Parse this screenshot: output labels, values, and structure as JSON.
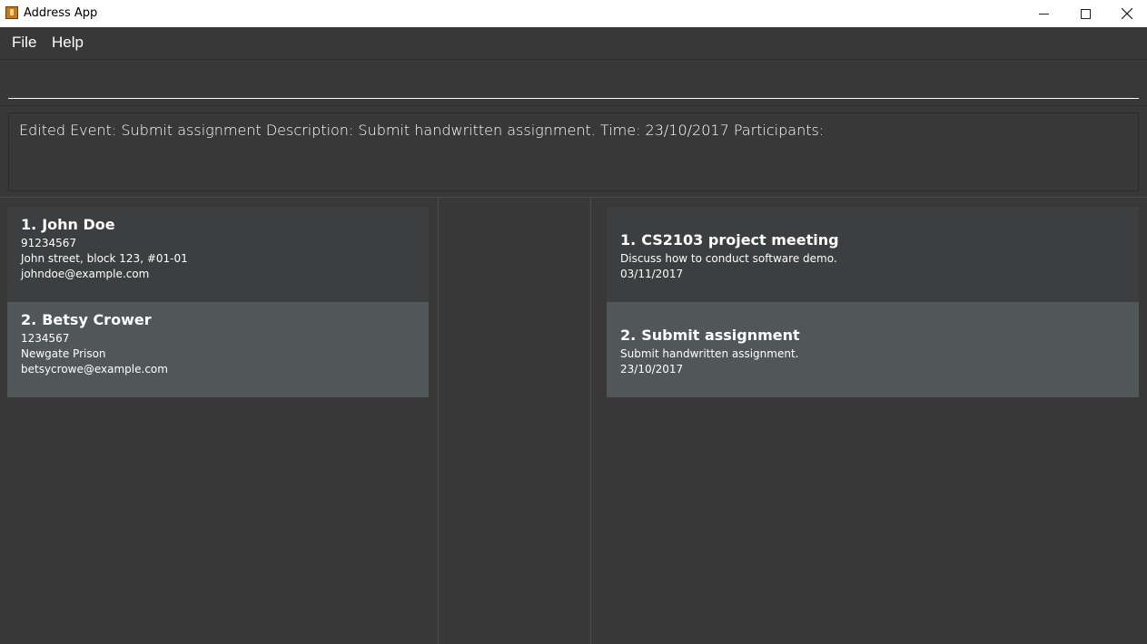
{
  "window": {
    "title": "Address App",
    "controls": [
      "minimize",
      "maximize",
      "close"
    ]
  },
  "menu": {
    "items": [
      {
        "label": "File"
      },
      {
        "label": "Help"
      }
    ]
  },
  "command_box": {
    "value": "",
    "placeholder": ""
  },
  "result_display": {
    "text": "Edited Event: Submit assignment Description: Submit handwritten assignment. Time: 23/10/2017 Participants:"
  },
  "persons": [
    {
      "index": "1.",
      "name": "John Doe",
      "phone": "91234567",
      "address": "John street, block 123, #01-01",
      "email": "johndoe@example.com"
    },
    {
      "index": "2.",
      "name": "Betsy Crower",
      "phone": "1234567",
      "address": "Newgate Prison",
      "email": "betsycrowe@example.com"
    }
  ],
  "events": [
    {
      "index": "1.",
      "title": "CS2103 project meeting",
      "description": "Discuss how to conduct software demo.",
      "date": "03/11/2017"
    },
    {
      "index": "2.",
      "title": "Submit assignment",
      "description": "Submit handwritten assignment.",
      "date": "23/10/2017"
    }
  ],
  "colors": {
    "background": "#383838",
    "card_odd": "#3c3e3f",
    "card_even": "#515658",
    "text": "#ffffff"
  }
}
